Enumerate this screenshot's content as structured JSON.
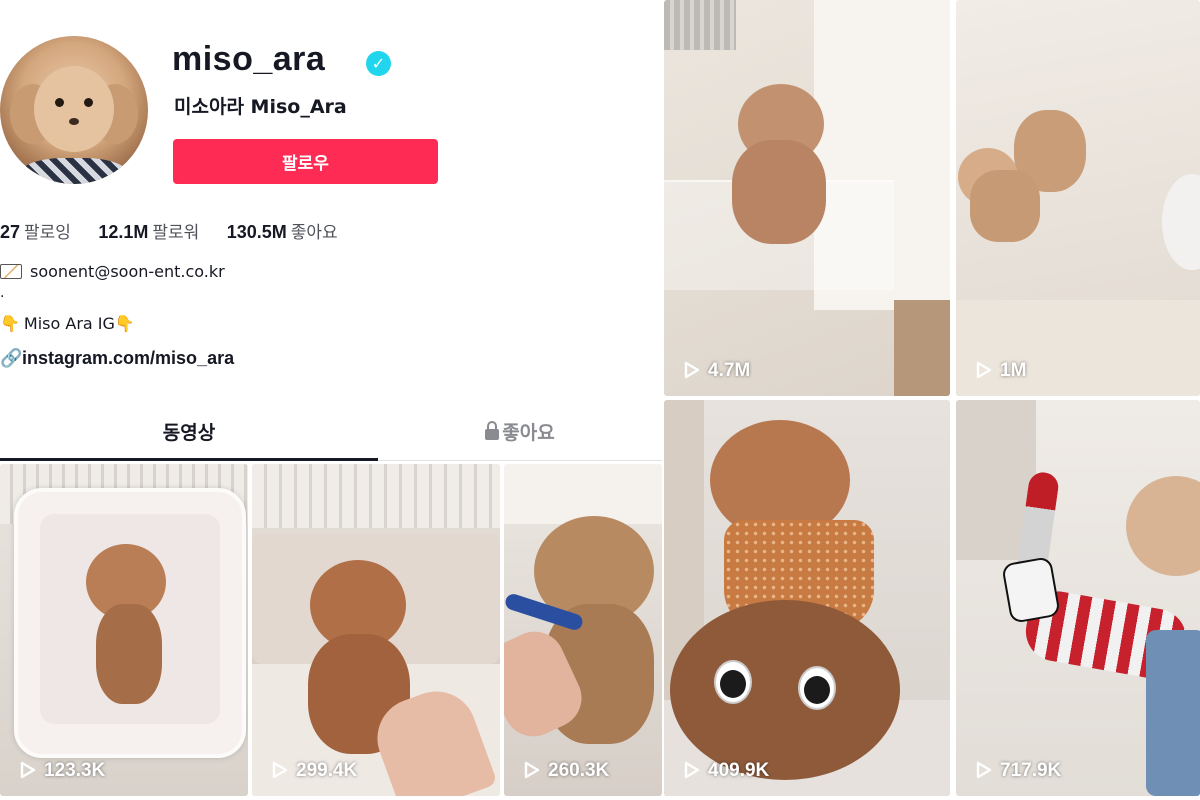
{
  "profile": {
    "username": "miso_ara",
    "nickname": "미소아라 Miso_Ara",
    "follow_label": "팔로우",
    "verified": true
  },
  "stats": {
    "following_count": "27",
    "following_label": "팔로잉",
    "followers_count": "12.1M",
    "followers_label": "팔로워",
    "likes_count": "130.5M",
    "likes_label": "좋아요"
  },
  "bio": {
    "email": "soonent@soon-ent.co.kr",
    "dot": ".",
    "ig_line": "Miso Ara IG",
    "link": "instagram.com/miso_ara"
  },
  "tabs": {
    "videos": "동영상",
    "liked": "좋아요"
  },
  "videos": [
    {
      "views": "123.3K"
    },
    {
      "views": "299.4K"
    },
    {
      "views": "260.3K"
    }
  ],
  "right_videos": [
    {
      "views": "4.7M"
    },
    {
      "views": "1M"
    },
    {
      "views": "409.9K"
    },
    {
      "views": "717.9K"
    }
  ],
  "colors": {
    "follow_button": "#fe2c55",
    "verified_badge": "#20d5ec",
    "text_primary": "#161823"
  }
}
